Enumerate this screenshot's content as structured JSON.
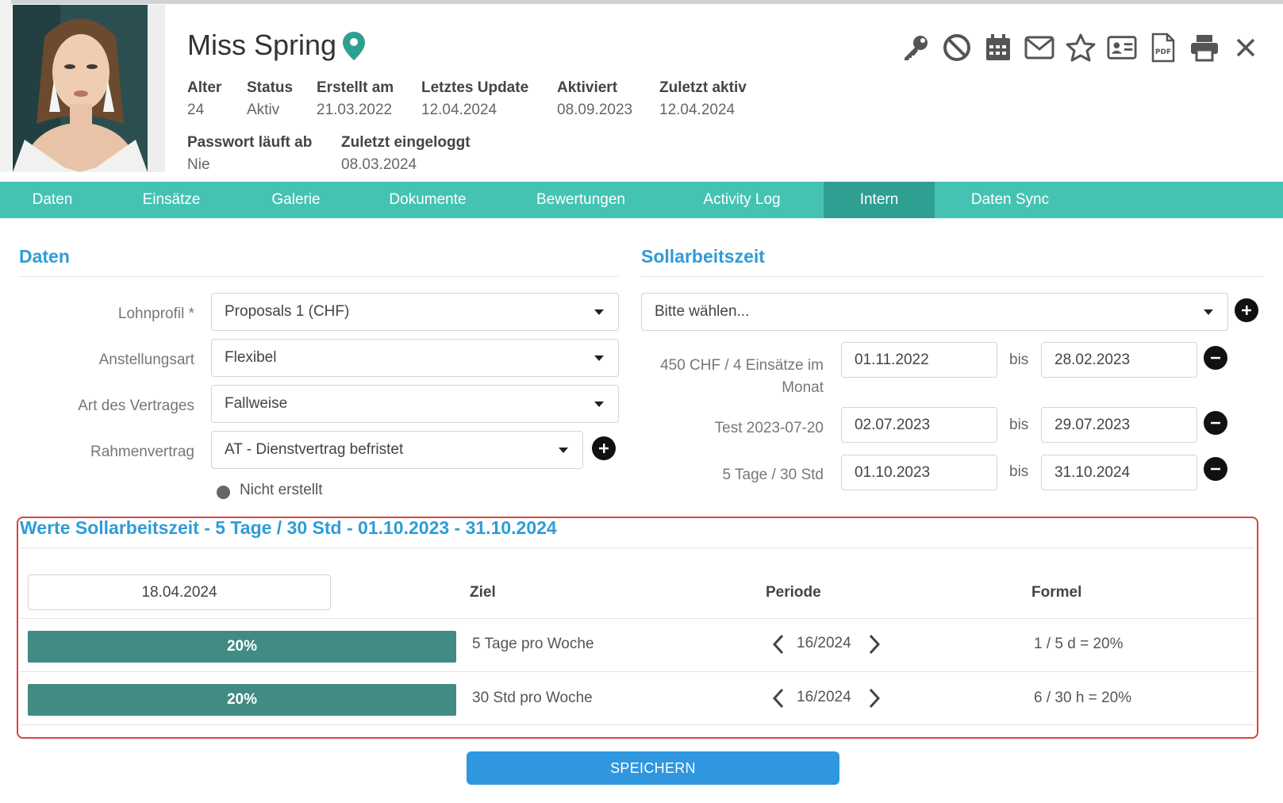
{
  "profile": {
    "name": "Miss Spring",
    "fields_row1": [
      {
        "label": "Alter",
        "value": "24"
      },
      {
        "label": "Status",
        "value": "Aktiv"
      },
      {
        "label": "Erstellt am",
        "value": "21.03.2022"
      },
      {
        "label": "Letztes Update",
        "value": "12.04.2024"
      },
      {
        "label": "Aktiviert",
        "value": "08.09.2023"
      },
      {
        "label": "Zuletzt aktiv",
        "value": "12.04.2024"
      }
    ],
    "fields_row2": [
      {
        "label": "Passwort läuft ab",
        "value": "Nie"
      },
      {
        "label": "Zuletzt eingeloggt",
        "value": "08.03.2024"
      }
    ]
  },
  "toolbar_icons": [
    "key-icon",
    "ban-icon",
    "calendar-icon",
    "mail-icon",
    "star-icon",
    "id-card-icon",
    "pdf-icon",
    "print-icon",
    "close-icon"
  ],
  "tabs": [
    {
      "label": "Daten"
    },
    {
      "label": "Einsätze"
    },
    {
      "label": "Galerie"
    },
    {
      "label": "Dokumente"
    },
    {
      "label": "Bewertungen"
    },
    {
      "label": "Activity Log"
    },
    {
      "label": "Intern",
      "active": true
    },
    {
      "label": "Daten Sync"
    }
  ],
  "daten": {
    "title": "Daten",
    "lohnprofil": {
      "label": "Lohnprofil *",
      "value": "Proposals 1 (CHF)"
    },
    "anstellungsart": {
      "label": "Anstellungsart",
      "value": "Flexibel"
    },
    "art_vertrag": {
      "label": "Art des Vertrages",
      "value": "Fallweise"
    },
    "rahmenvertrag": {
      "label": "Rahmenvertrag",
      "value": "AT - Dienstvertrag befristet"
    },
    "status_text": "Nicht erstellt"
  },
  "soll": {
    "title": "Sollarbeitszeit",
    "select_placeholder": "Bitte wählen...",
    "bis": "bis",
    "rows": [
      {
        "label_line1": "450 CHF / 4 Einsätze im",
        "label_line2": "Monat",
        "from": "01.11.2022",
        "to": "28.02.2023"
      },
      {
        "label_line1": "Test 2023-07-20",
        "label_line2": "",
        "from": "02.07.2023",
        "to": "29.07.2023"
      },
      {
        "label_line1": "5 Tage / 30 Std",
        "label_line2": "",
        "from": "01.10.2023",
        "to": "31.10.2024"
      }
    ]
  },
  "werte": {
    "title": "Werte Sollarbeitszeit - 5 Tage / 30 Std - 01.10.2023 - 31.10.2024",
    "date": "18.04.2024",
    "headers": {
      "ziel": "Ziel",
      "periode": "Periode",
      "formel": "Formel"
    },
    "rows": [
      {
        "progress": 20,
        "progress_label": "20%",
        "ziel": "5 Tage pro Woche",
        "periode": "16/2024",
        "formel": "1 / 5 d = 20%"
      },
      {
        "progress": 20,
        "progress_label": "20%",
        "ziel": "30 Std pro Woche",
        "periode": "16/2024",
        "formel": "6 / 30 h = 20%"
      }
    ]
  },
  "save_label": "SPEICHERN",
  "colors": {
    "tab_bar": "#45c3b2",
    "tab_active": "#2f9f92",
    "section_title": "#2f9cd6",
    "progress": "#428a84",
    "save_button": "#2f96e0",
    "highlight_border": "#d9433d"
  }
}
